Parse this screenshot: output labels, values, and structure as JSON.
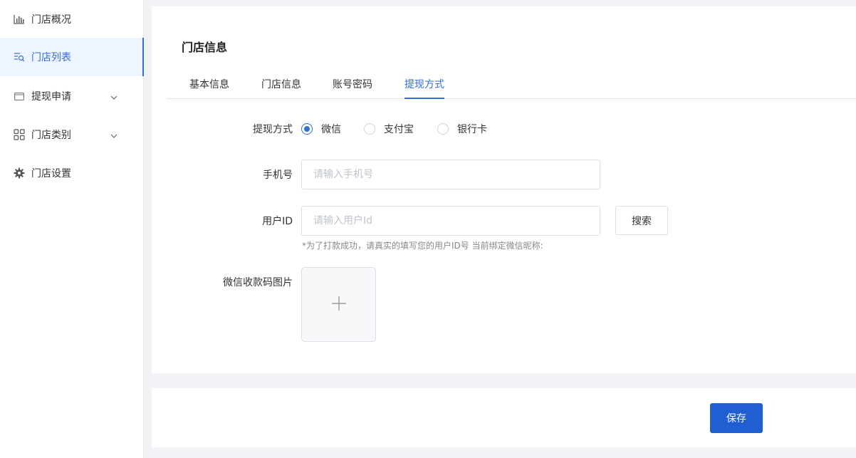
{
  "sidebar": {
    "items": [
      {
        "label": "门店概况",
        "icon": "bar-chart-icon"
      },
      {
        "label": "门店列表",
        "icon": "list-search-icon",
        "active": true
      },
      {
        "label": "提现申请",
        "icon": "wallet-icon",
        "has_submenu": true
      },
      {
        "label": "门店类别",
        "icon": "grid-icon",
        "has_submenu": true
      },
      {
        "label": "门店设置",
        "icon": "gear-icon"
      }
    ]
  },
  "page": {
    "title": "门店信息",
    "tabs": [
      "基本信息",
      "门店信息",
      "账号密码",
      "提现方式"
    ],
    "active_tab": "提现方式"
  },
  "form": {
    "withdraw_method": {
      "label": "提现方式",
      "options": [
        "微信",
        "支付宝",
        "银行卡"
      ],
      "selected": "微信"
    },
    "phone": {
      "label": "手机号",
      "placeholder": "请输入手机号",
      "value": ""
    },
    "user_id": {
      "label": "用户ID",
      "placeholder": "请输入用户Id",
      "value": "",
      "search_label": "搜索",
      "hint": "*为了打款成功，请真实的填写您的用户ID号 当前绑定微信昵称:"
    },
    "qr_image": {
      "label": "微信收款码图片",
      "upload_icon": "plus-icon"
    }
  },
  "footer": {
    "save_label": "保存"
  },
  "colors": {
    "accent": "#2f6fd6",
    "primary_button": "#1f5fd1",
    "active_bg": "#eef5fe"
  }
}
